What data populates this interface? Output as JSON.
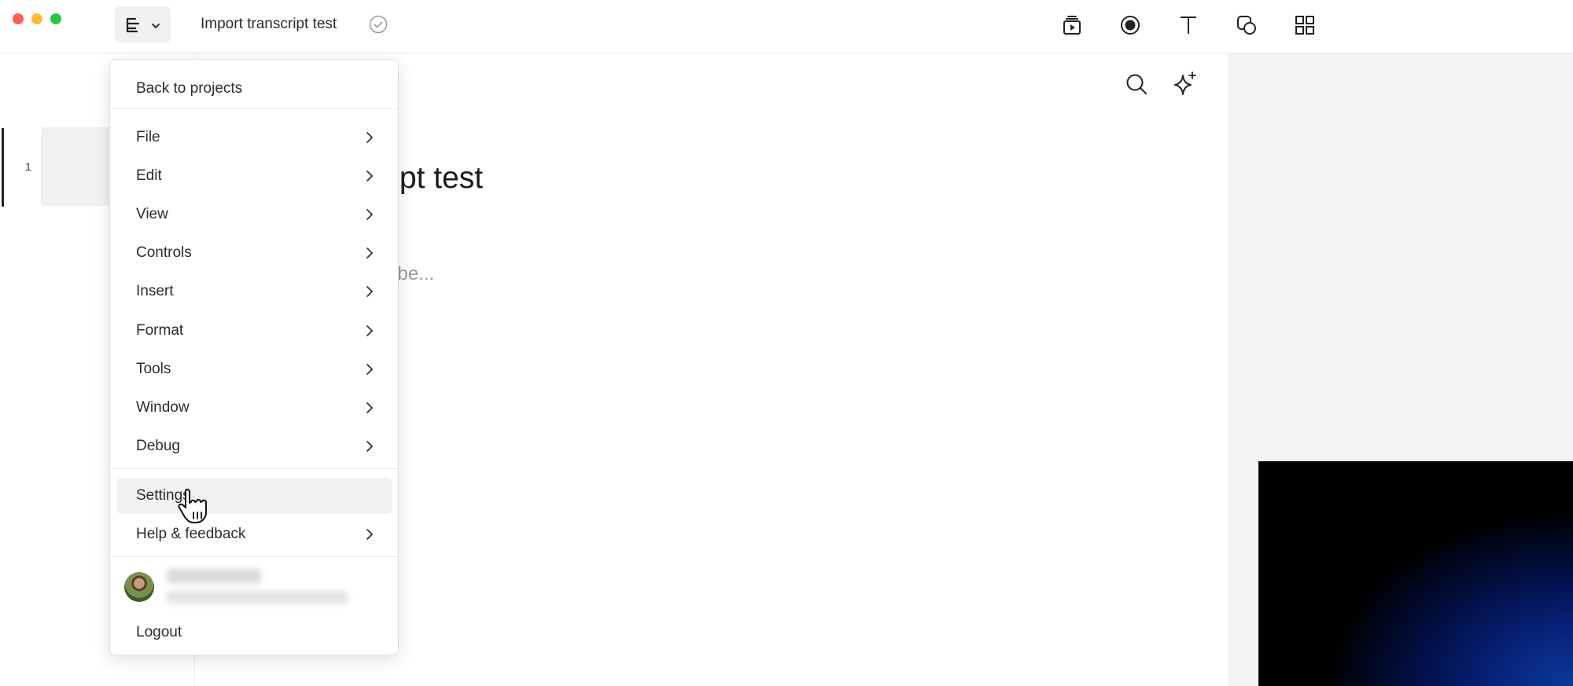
{
  "window": {
    "title": "Import transcript test"
  },
  "toolbar": {
    "menu_icon": "list-icon",
    "status_icon": "check-circle-icon",
    "tools": [
      {
        "name": "media-icon"
      },
      {
        "name": "record-icon"
      },
      {
        "name": "text-icon"
      },
      {
        "name": "shapes-icon"
      },
      {
        "name": "grid-icon"
      }
    ]
  },
  "scenes": {
    "items": [
      {
        "number": "1"
      }
    ]
  },
  "editor": {
    "heading_visible": "transcript test",
    "placeholder_visible": "e to transcribe..."
  },
  "menu": {
    "back_label": "Back to projects",
    "items": [
      {
        "label": "File"
      },
      {
        "label": "Edit"
      },
      {
        "label": "View"
      },
      {
        "label": "Controls"
      },
      {
        "label": "Insert"
      },
      {
        "label": "Format"
      },
      {
        "label": "Tools"
      },
      {
        "label": "Window"
      },
      {
        "label": "Debug"
      }
    ],
    "settings_label": "Settings",
    "help_label": "Help & feedback",
    "logout_label": "Logout"
  }
}
